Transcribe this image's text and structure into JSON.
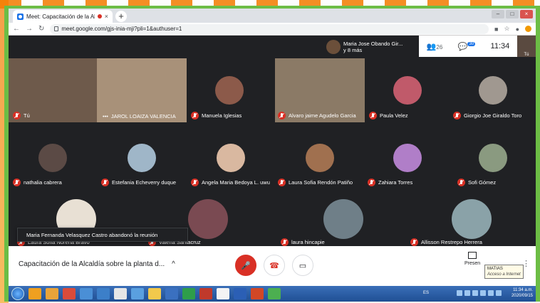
{
  "browser": {
    "tab_title": "Meet: Capacitación de la Alc",
    "tab_close": "×",
    "new_tab": "+",
    "url": "meet.google.com/gjs-inia-mji?pli=1&authuser=1",
    "win_min": "–",
    "win_max": "□",
    "win_close": "×"
  },
  "meet": {
    "presenter_name": "Maria Jose Obando Gir...",
    "presenter_more": "y 8 más",
    "participants_count": "26",
    "chat_badge": "30",
    "clock": "11:34",
    "self_label": "Tú",
    "toast": "Maria Fernanda Velasquez Castro abandonó la reunión",
    "meeting_title": "Capacitación de la Alcaldía sobre la planta d...",
    "present_label": "Presen",
    "tooltip_name": "MATIAS",
    "tooltip_status": "Acceso a Internet",
    "tiles": [
      {
        "name": "Tú"
      },
      {
        "name": "JAROL LOAIZA VALENCIA"
      },
      {
        "name": "Manuela Iglesias"
      },
      {
        "name": "Alvaro jaime Agudelo Garcia"
      },
      {
        "name": "Paula Velez"
      },
      {
        "name": "Giorgio Joe Giraldo Toro"
      },
      {
        "name": "nathalia cabrera"
      },
      {
        "name": "Estefania Echeverry duque"
      },
      {
        "name": "Angela Maria Bedoya L. uwu"
      },
      {
        "name": "Laura Sofia Rendón Patiño"
      },
      {
        "name": "Zahiara Torres"
      },
      {
        "name": "Sofi Gómez"
      },
      {
        "name": "Laura Sofia Noreña Bravo"
      },
      {
        "name": "Valeria Santacruz"
      },
      {
        "name": "laura hincapie"
      },
      {
        "name": "Allisson Restrepo Herrera"
      }
    ]
  },
  "taskbar": {
    "lang": "ES",
    "time": "11:34 a.m.",
    "date": "2020/09/15"
  },
  "colors": {
    "meet_bg": "#202124",
    "red": "#d93025",
    "frame_green": "#6cbd45",
    "frame_orange": "#f57c00"
  }
}
